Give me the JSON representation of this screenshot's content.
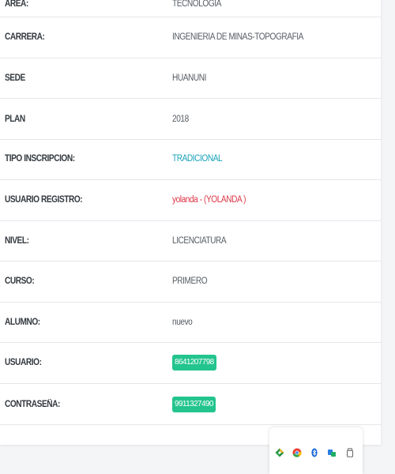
{
  "rows": [
    {
      "label": "AREA:",
      "value": "TECNOLOGIA",
      "style": "normal"
    },
    {
      "label": "CARRERA:",
      "value": "INGENIERIA DE MINAS-TOPOGRAFIA",
      "style": "normal"
    },
    {
      "label": "SEDE",
      "value": "HUANUNI",
      "style": "normal"
    },
    {
      "label": "PLAN",
      "value": "2018",
      "style": "normal"
    },
    {
      "label": "TIPO INSCRIPCION:",
      "value": "TRADICIONAL",
      "style": "teal"
    },
    {
      "label": "USUARIO REGISTRO:",
      "value": "yolanda - (YOLANDA )",
      "style": "red"
    },
    {
      "label": "NIVEL:",
      "value": "LICENCIATURA",
      "style": "normal"
    },
    {
      "label": "CURSO:",
      "value": "PRIMERO",
      "style": "normal"
    },
    {
      "label": "ALUMNO:",
      "value": "nuevo",
      "style": "normal"
    },
    {
      "label": "USUARIO:",
      "value": "8641207798",
      "style": "badge"
    },
    {
      "label": "CONTRASEÑA:",
      "value": "9911327490",
      "style": "badge"
    }
  ],
  "colors": {
    "teal": "#17a2b8",
    "red": "#dc3545",
    "badge_bg": "#23c48e",
    "label": "#343a40",
    "value": "#565c63"
  },
  "tray": {
    "icons": [
      "maps-app-icon",
      "chrome-icon",
      "bluetooth-icon",
      "network-icon",
      "usb-drive-icon"
    ]
  }
}
